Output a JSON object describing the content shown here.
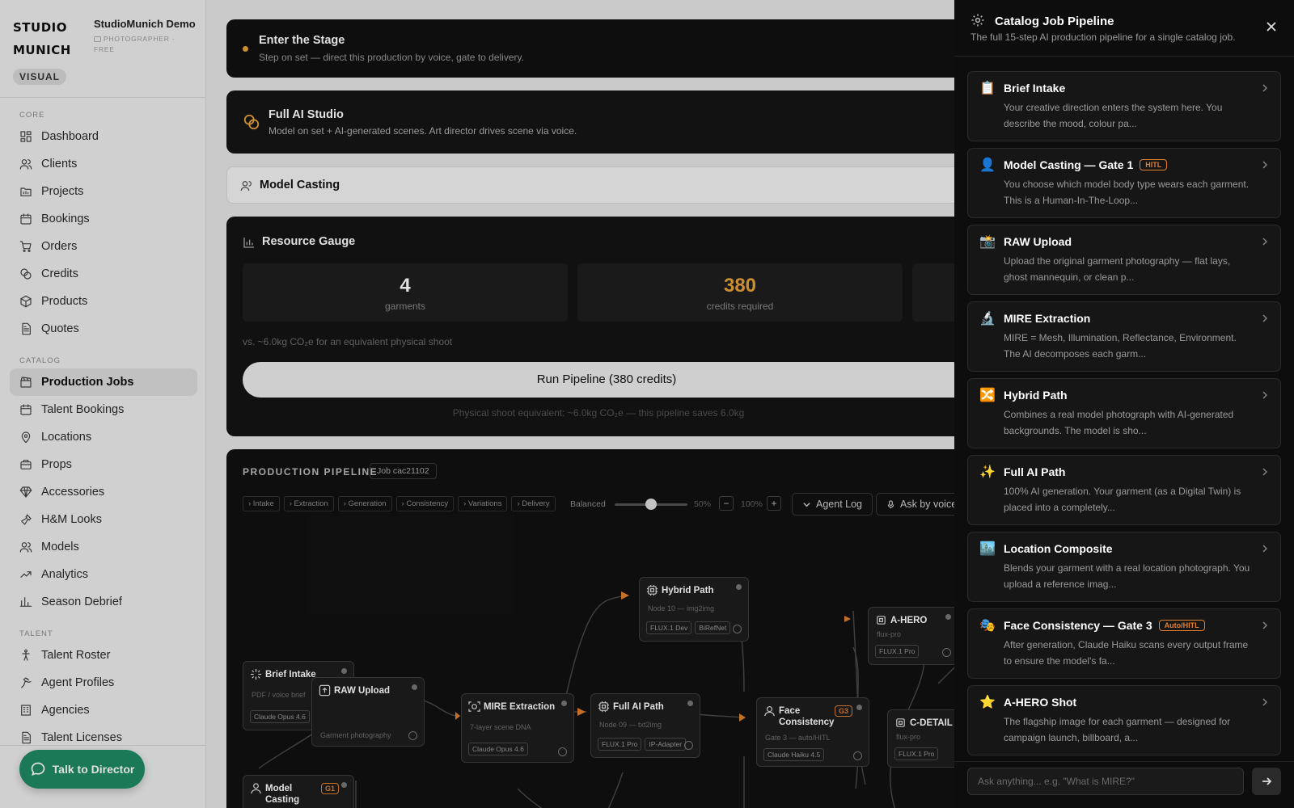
{
  "brand": {
    "logo_line1": "STUDIO",
    "logo_line2": "MUNICH",
    "name": "StudioMunich Demo",
    "sub": "PHOTOGRAPHER · FREE",
    "mode": "VISUAL"
  },
  "sidebar": {
    "sections": [
      {
        "label": "CORE",
        "items": [
          {
            "label": "Dashboard",
            "icon": "dashboard-icon"
          },
          {
            "label": "Clients",
            "icon": "users-icon"
          },
          {
            "label": "Projects",
            "icon": "folder-icon"
          },
          {
            "label": "Bookings",
            "icon": "calendar-icon"
          },
          {
            "label": "Orders",
            "icon": "cart-icon"
          },
          {
            "label": "Credits",
            "icon": "coins-icon"
          },
          {
            "label": "Products",
            "icon": "box-icon"
          },
          {
            "label": "Quotes",
            "icon": "document-icon"
          }
        ]
      },
      {
        "label": "CATALOG",
        "items": [
          {
            "label": "Production Jobs",
            "icon": "clapperboard-icon",
            "active": true
          },
          {
            "label": "Talent Bookings",
            "icon": "calendar-icon"
          },
          {
            "label": "Locations",
            "icon": "pin-icon"
          },
          {
            "label": "Props",
            "icon": "briefcase-icon"
          },
          {
            "label": "Accessories",
            "icon": "gem-icon"
          },
          {
            "label": "H&M Looks",
            "icon": "shirt-icon"
          },
          {
            "label": "Models",
            "icon": "users-icon"
          },
          {
            "label": "Analytics",
            "icon": "trend-icon"
          },
          {
            "label": "Season Debrief",
            "icon": "bar-chart-icon"
          }
        ]
      },
      {
        "label": "TALENT",
        "items": [
          {
            "label": "Talent Roster",
            "icon": "person-icon"
          },
          {
            "label": "Agent Profiles",
            "icon": "agent-icon"
          },
          {
            "label": "Agencies",
            "icon": "building-icon"
          },
          {
            "label": "Talent Licenses",
            "icon": "document-icon"
          }
        ]
      }
    ],
    "talk_button": "Talk to Director"
  },
  "main": {
    "stage": {
      "title": "Enter the Stage",
      "subtitle": "Step on set — direct this production by voice, gate to delivery.",
      "accent": "#e8a33a"
    },
    "full_ai": {
      "title": "Full AI Studio",
      "subtitle": "Model on set + AI-generated scenes. Art director drives scene via voice."
    },
    "casting": {
      "title": "Model Casting"
    },
    "gauge": {
      "title": "Resource Gauge",
      "stats": [
        {
          "value": "4",
          "label": "garments",
          "color": "#ffffff"
        },
        {
          "value": "380",
          "label": "credits required",
          "color": "#e8a33a"
        }
      ],
      "note": "vs. ~6.0kg CO₂e for an equivalent physical shoot",
      "run_button": "Run Pipeline (380 credits)",
      "footer": "Physical shoot equivalent: ~6.0kg CO₂e — this pipeline saves 6.0kg"
    },
    "pipeline": {
      "heading": "PRODUCTION PIPELINE",
      "job": "Job cac21102",
      "filters": [
        "Intake",
        "Extraction",
        "Generation",
        "Consistency",
        "Variations",
        "Delivery"
      ],
      "balance_label": "Balanced",
      "balance_value": 0.5,
      "balance_pct": "50%",
      "zoom_minus": "−",
      "zoom": "100%",
      "zoom_plus": "+",
      "agent_log": "Agent Log",
      "ask_voice": "Ask by voice",
      "nodes": {
        "brief": {
          "title": "Brief Intake",
          "sub": "PDF / voice brief",
          "tags": [
            "Claude Opus 4.6"
          ]
        },
        "raw": {
          "title": "RAW Upload",
          "sub": "Garment photography"
        },
        "mire": {
          "title": "MIRE Extraction",
          "sub": "7-layer scene DNA",
          "tags": [
            "Claude Opus 4.6"
          ]
        },
        "hybrid": {
          "title": "Hybrid Path",
          "sub": "Node 10 — img2img",
          "tags": [
            "FLUX.1 Dev",
            "BiRefNet"
          ]
        },
        "fullai": {
          "title": "Full AI Path",
          "sub": "Node 09 — txt2img",
          "tags": [
            "FLUX.1 Pro",
            "IP-Adapter"
          ]
        },
        "face": {
          "title": "Face Consistency",
          "sub": "Gate 3 — auto/HITL",
          "tags": [
            "Claude Haiku 4.5"
          ],
          "gate": "G3"
        },
        "ahero": {
          "title": "A-HERO",
          "sub": "flux-pro",
          "tags": [
            "FLUX.1 Pro"
          ]
        },
        "cdetail": {
          "title": "C-DETAIL",
          "sub": "flux-pro",
          "tags": [
            "FLUX.1 Pro"
          ]
        },
        "casting": {
          "title": "Model Casting",
          "gate": "G1"
        }
      }
    }
  },
  "panel": {
    "title": "Catalog Job Pipeline",
    "subtitle": "The full 15-step AI production pipeline for a single catalog job.",
    "items": [
      {
        "emoji": "📋",
        "title": "Brief Intake",
        "desc": "Your creative direction enters the system here. You describe the mood, colour pa..."
      },
      {
        "emoji": "👤",
        "title": "Model Casting — Gate 1",
        "badge": "HITL",
        "desc": "You choose which model body type wears each garment. This is a Human-In-The-Loop..."
      },
      {
        "emoji": "📸",
        "title": "RAW Upload",
        "desc": "Upload the original garment photography — flat lays, ghost mannequin, or clean p..."
      },
      {
        "emoji": "🔬",
        "title": "MIRE Extraction",
        "desc": "MIRE = Mesh, Illumination, Reflectance, Environment. The AI decomposes each garm..."
      },
      {
        "emoji": "🔀",
        "title": "Hybrid Path",
        "desc": "Combines a real model photograph with AI-generated backgrounds. The model is sho..."
      },
      {
        "emoji": "✨",
        "title": "Full AI Path",
        "desc": "100% AI generation. Your garment (as a Digital Twin) is placed into a completely..."
      },
      {
        "emoji": "🏙️",
        "title": "Location Composite",
        "desc": "Blends your garment with a real location photograph. You upload a reference imag..."
      },
      {
        "emoji": "🎭",
        "title": "Face Consistency — Gate 3",
        "badge": "Auto/HITL",
        "desc": "After generation, Claude Haiku scans every output frame to ensure the model's fa..."
      },
      {
        "emoji": "⭐",
        "title": "A-HERO Shot",
        "desc": "The flagship image for each garment — designed for campaign launch, billboard, a..."
      }
    ],
    "ask_placeholder": "Ask anything... e.g. \"What is MIRE?\""
  }
}
